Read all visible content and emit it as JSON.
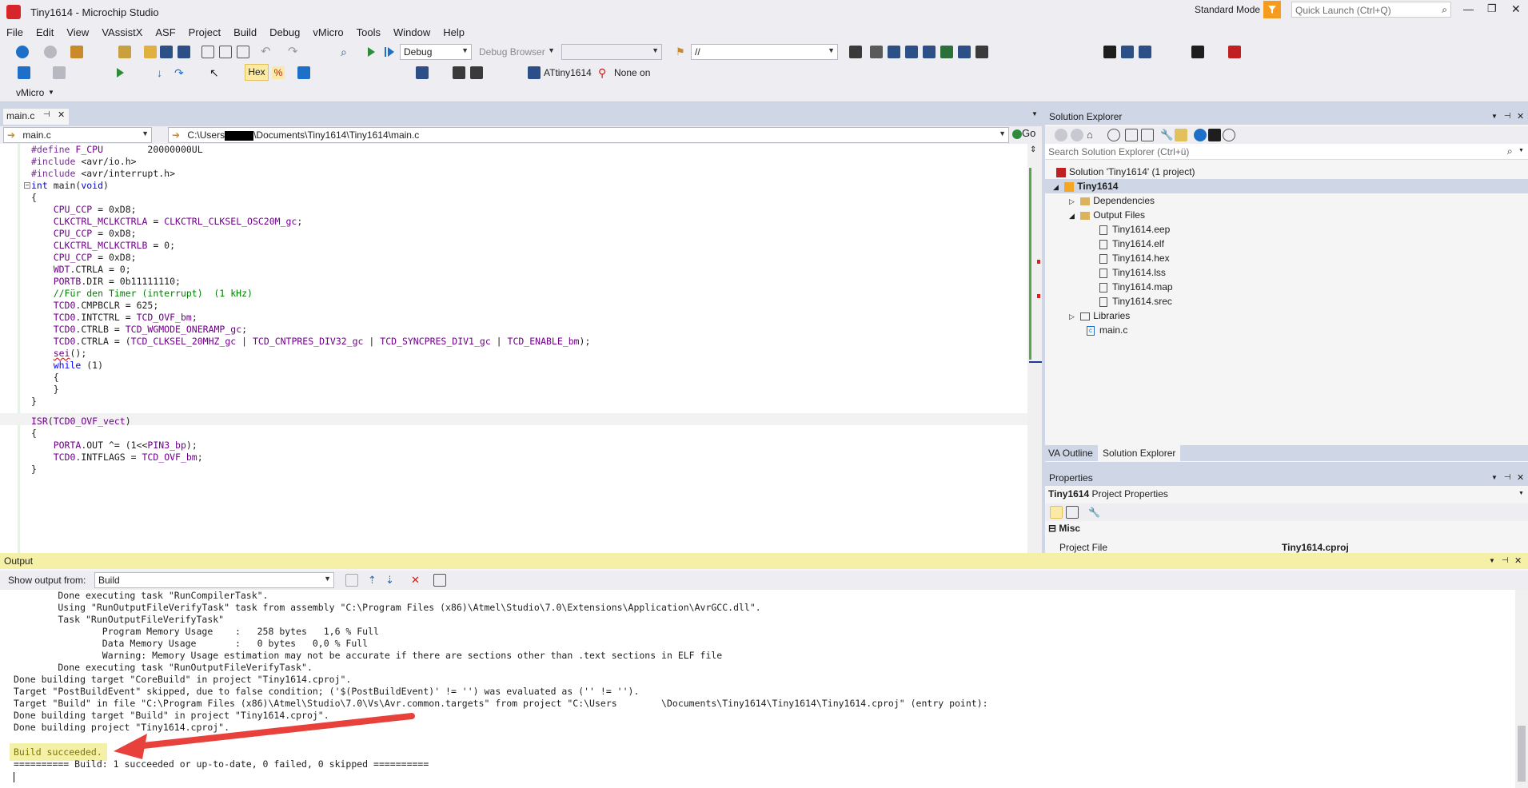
{
  "window": {
    "title": "Tiny1614 - Microchip Studio",
    "mode": "Standard Mode",
    "quick_launch_placeholder": "Quick Launch (Ctrl+Q)"
  },
  "menu": [
    "File",
    "Edit",
    "View",
    "VAssistX",
    "ASF",
    "Project",
    "Build",
    "Debug",
    "vMicro",
    "Tools",
    "Window",
    "Help"
  ],
  "toolbar": {
    "config": "Debug",
    "debug_browser": "Debug Browser",
    "find_combo": "//",
    "hex_label": "Hex",
    "device": "ATtiny1614",
    "tool": "None on",
    "vmicro": "vMicro"
  },
  "doc_tab": {
    "label": "main.c"
  },
  "navbar": {
    "file_combo": "main.c",
    "path": "C:\\Users\\Documents\\Tiny1614\\Tiny1614\\main.c",
    "path_prefix": "C:\\Users",
    "path_suffix": "\\Documents\\Tiny1614\\Tiny1614\\main.c",
    "go": "Go"
  },
  "code": [
    "#define F_CPU        20000000UL",
    "#include <avr/io.h>",
    "#include <avr/interrupt.h>",
    "int main(void)",
    "{",
    "    CPU_CCP = 0xD8;",
    "    CLKCTRL_MCLKCTRLA = CLKCTRL_CLKSEL_OSC20M_gc;",
    "    CPU_CCP = 0xD8;",
    "    CLKCTRL_MCLKCTRLB = 0;",
    "    CPU_CCP = 0xD8;",
    "    WDT.CTRLA = 0;",
    "    PORTB.DIR = 0b11111110;",
    "    //Für den Timer (interrupt)  (1 kHz)",
    "    TCD0.CMPBCLR = 625;",
    "    TCD0.INTCTRL = TCD_OVF_bm;",
    "    TCD0.CTRLB = TCD_WGMODE_ONERAMP_gc;",
    "    TCD0.CTRLA = (TCD_CLKSEL_20MHZ_gc | TCD_CNTPRES_DIV32_gc | TCD_SYNCPRES_DIV1_gc | TCD_ENABLE_bm);",
    "    sei();",
    "    while (1)",
    "    {",
    "    }",
    "}",
    "ISR(TCD0_OVF_vect)",
    "{",
    "    PORTA.OUT ^= (1<<PIN3_bp);",
    "    TCD0.INTFLAGS = TCD_OVF_bm;",
    "}"
  ],
  "solution_explorer": {
    "title": "Solution Explorer",
    "search_placeholder": "Search Solution Explorer (Ctrl+ü)",
    "solution": "Solution 'Tiny1614' (1 project)",
    "project": "Tiny1614",
    "dependencies": "Dependencies",
    "output_files": "Output Files",
    "files": [
      "Tiny1614.eep",
      "Tiny1614.elf",
      "Tiny1614.hex",
      "Tiny1614.lss",
      "Tiny1614.map",
      "Tiny1614.srec"
    ],
    "libraries": "Libraries",
    "main_c": "main.c",
    "tabs": [
      "VA Outline",
      "Solution Explorer"
    ]
  },
  "properties": {
    "title": "Properties",
    "object": "Tiny1614",
    "object_type": "Project Properties",
    "category": "Misc",
    "row_name": "Project File",
    "row_value": "Tiny1614.cproj"
  },
  "output": {
    "title": "Output",
    "show_from_label": "Show output from:",
    "show_from_value": "Build",
    "lines": [
      "        Done executing task \"RunCompilerTask\".",
      "        Using \"RunOutputFileVerifyTask\" task from assembly \"C:\\Program Files (x86)\\Atmel\\Studio\\7.0\\Extensions\\Application\\AvrGCC.dll\".",
      "        Task \"RunOutputFileVerifyTask\"",
      "                Program Memory Usage    :   258 bytes   1,6 % Full",
      "                Data Memory Usage       :   0 bytes   0,0 % Full",
      "                Warning: Memory Usage estimation may not be accurate if there are sections other than .text sections in ELF file",
      "        Done executing task \"RunOutputFileVerifyTask\".",
      "Done building target \"CoreBuild\" in project \"Tiny1614.cproj\".",
      "Target \"PostBuildEvent\" skipped, due to false condition; ('$(PostBuildEvent)' != '') was evaluated as ('' != '').",
      "Target \"Build\" in file \"C:\\Program Files (x86)\\Atmel\\Studio\\7.0\\Vs\\Avr.common.targets\" from project \"C:\\Users        \\Documents\\Tiny1614\\Tiny1614\\Tiny1614.cproj\" (entry point):",
      "Done building target \"Build\" in project \"Tiny1614.cproj\".",
      "Done building project \"Tiny1614.cproj\".",
      "",
      "Build succeeded.",
      "========== Build: 1 succeeded or up-to-date, 0 failed, 0 skipped =========="
    ]
  },
  "colors": {
    "accent_bar": "#1f3c6b",
    "build_highlight": "#f5f0a8",
    "arrow": "#e8413c",
    "filter_icon": "#f59b1f"
  }
}
